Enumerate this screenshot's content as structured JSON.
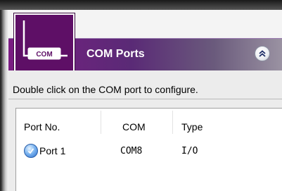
{
  "panel": {
    "title": "COM Ports",
    "description": "Double click on the COM port to configure.",
    "icon_label": "COM",
    "colors": {
      "title_bar": "#6a237f",
      "icon_bg": "#5e0f66"
    }
  },
  "table": {
    "columns": [
      "Port No.",
      "COM",
      "Type"
    ],
    "rows": [
      {
        "port": "Port 1",
        "com": "COM8",
        "type": "I/O",
        "status_icon": "check-circle-icon"
      }
    ]
  }
}
